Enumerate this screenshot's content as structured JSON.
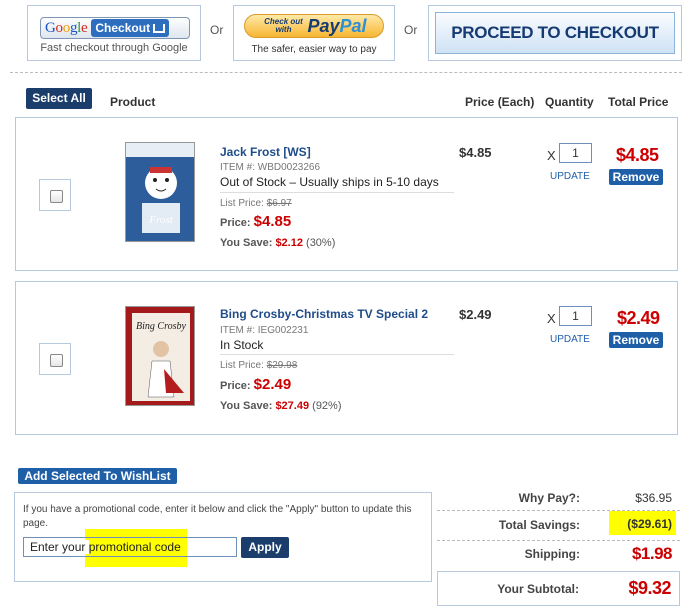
{
  "checkout": {
    "google_brand": "Google",
    "google_button": "Checkout",
    "google_caption": "Fast checkout through Google",
    "or1": "Or",
    "paypal_prefix_line1": "Check out",
    "paypal_prefix_line2": "with",
    "paypal_brand_1": "Pay",
    "paypal_brand_2": "Pal",
    "paypal_caption": "The safer, easier way to pay",
    "or2": "Or",
    "proceed": "PROCEED TO CHECKOUT"
  },
  "cart_header": {
    "select_all": "Select All",
    "product": "Product",
    "price_each": "Price (Each)",
    "quantity": "Quantity",
    "total_price": "Total Price"
  },
  "items": [
    {
      "title": "Jack Frost [WS]",
      "item_no": "ITEM #: WBD0023266",
      "stock": "Out of Stock – Usually ships in 5-10 days",
      "list_label": "List Price:",
      "list_price": "$6.97",
      "price_label": "Price:",
      "price": "$4.85",
      "save_label": "You Save:",
      "save_amount": "$2.12",
      "save_pct": "(30%)",
      "each": "$4.85",
      "x": "X",
      "qty": "1",
      "update": "UPDATE",
      "total": "$4.85",
      "remove": "Remove",
      "thumb_colors": {
        "primary": "#3b6fb0",
        "secondary": "#e9eef5"
      }
    },
    {
      "title": "Bing Crosby-Christmas TV Special 2",
      "item_no": "ITEM #: IEG002231",
      "stock": "In Stock",
      "list_label": "List Price:",
      "list_price": "$29.98",
      "price_label": "Price:",
      "price": "$2.49",
      "save_label": "You Save:",
      "save_amount": "$27.49",
      "save_pct": "(92%)",
      "each": "$2.49",
      "x": "X",
      "qty": "1",
      "update": "UPDATE",
      "total": "$2.49",
      "remove": "Remove",
      "thumb_colors": {
        "primary": "#b01c1c",
        "secondary": "#f3ece4"
      }
    }
  ],
  "wishlist_button": "Add Selected To WishList",
  "promo": {
    "instructions": "If you have a promotional code, enter it below and click the \"Apply\" button to update this page.",
    "placeholder_prefix": "Enter your ",
    "placeholder_highlight": "promotional code",
    "apply": "Apply"
  },
  "summary": {
    "why_pay_label": "Why Pay?:",
    "why_pay": "$36.95",
    "savings_label": "Total Savings:",
    "savings": "($29.61)",
    "shipping_label": "Shipping:",
    "shipping": "$1.98",
    "subtotal_label": "Your Subtotal:",
    "subtotal": "$9.32"
  },
  "colors": {
    "accent_blue": "#1f5fa8",
    "dark_blue": "#1b3d6b",
    "price_red": "#cc0000",
    "highlight": "#ffff00"
  }
}
